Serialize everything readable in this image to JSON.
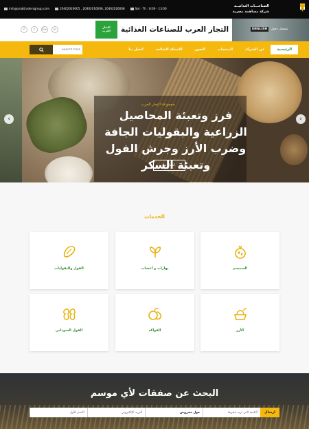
{
  "topbar": {
    "email": "info@arabtradersgroup.com",
    "phones": "20402026005 , 20402016006, 20402026008",
    "hours": "Sat - Th : 8:00 - 13:00",
    "brand_line1": "الصناعـــات الغذائيــة",
    "brand_line2": "شركة مساهمة مصرية"
  },
  "header": {
    "social": [
      "f",
      "t",
      "G+",
      "in"
    ],
    "logo_text_line1": "التجار",
    "logo_text_line2": "العرب",
    "site_title": "التجار العرب للصناعات الغذائية",
    "lang_label": "ENGLISH",
    "login_label": "تسجيل دخول"
  },
  "nav": {
    "search_placeholder": "Search here",
    "items": [
      "الرئيسية",
      "عن الشركة",
      "المنتجات",
      "الصور",
      "الاسئلة الشائعة",
      "اتصل بنا"
    ]
  },
  "hero": {
    "subtitle": "مجموعة التجار العرب",
    "title": "فرز وتعبئة المحاصيل الزراعية والبقوليات الجافة وضرب الأرز وجرش الفول وتعبئة السكر",
    "button": "اتصل بنا"
  },
  "services": {
    "title": "الخدمات",
    "items": [
      {
        "label": "الفول والبقوليات",
        "icon": "bean-icon"
      },
      {
        "label": "بهارات و أعشاب",
        "icon": "herb-icon"
      },
      {
        "label": "السمسم",
        "icon": "sesame-icon"
      },
      {
        "label": "الفول السوداني",
        "icon": "peanut-icon"
      },
      {
        "label": "الفواكه",
        "icon": "fruit-icon"
      },
      {
        "label": "الأرز",
        "icon": "rice-icon"
      }
    ]
  },
  "deals": {
    "title": "البحث عن صفقات لأي موسم",
    "send": "ارسال",
    "fields": [
      "الكمية التي تريد حجزها",
      "فول مجروش",
      "البريد الإلكتروني",
      "الاسم الأول"
    ]
  },
  "colors": {
    "accent": "#f5b80e",
    "green": "#2aa33b",
    "dark": "#0b0b0b"
  }
}
